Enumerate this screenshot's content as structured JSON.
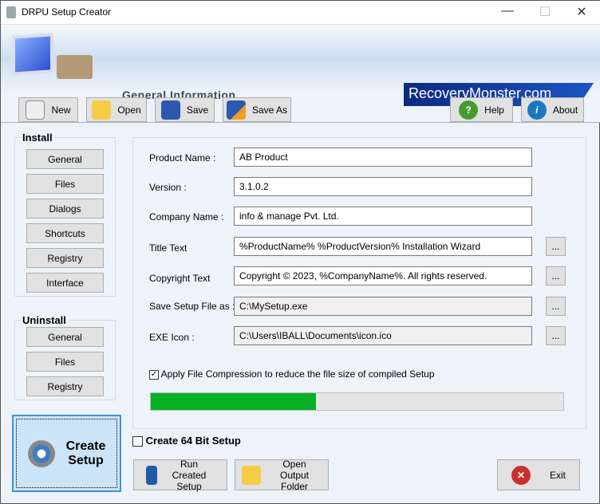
{
  "window": {
    "title": "DRPU Setup Creator",
    "minimize": "—",
    "maximize": "☐",
    "close": "✕"
  },
  "header": {
    "title": "General Information",
    "brand": "RecoveryMonster.com"
  },
  "toolbar": {
    "new": "New",
    "open": "Open",
    "save": "Save",
    "save_as": "Save As",
    "help": "Help",
    "about": "About"
  },
  "install": {
    "label": "Install",
    "items": [
      "General",
      "Files",
      "Dialogs",
      "Shortcuts",
      "Registry",
      "Interface"
    ]
  },
  "uninstall": {
    "label": "Uninstall",
    "items": [
      "General",
      "Files",
      "Registry"
    ]
  },
  "create_setup": {
    "line1": "Create",
    "line2": "Setup"
  },
  "form": {
    "fields": [
      {
        "label": "Product Name :",
        "value": "AB Product"
      },
      {
        "label": "Version :",
        "value": "3.1.0.2"
      },
      {
        "label": "Company Name :",
        "value": "info & manage Pvt. Ltd."
      },
      {
        "label": "Title Text",
        "value": "%ProductName% %ProductVersion% Installation Wizard"
      },
      {
        "label": "Copyright Text",
        "value": "Copyright © 2023, %CompanyName%. All rights reserved."
      },
      {
        "label": "Save Setup File as :",
        "value": "C:\\MySetup.exe"
      },
      {
        "label": "EXE Icon :",
        "value": "C:\\Users\\IBALL\\Documents\\icon.ico"
      }
    ],
    "browse": "...",
    "compression_label": "Apply File Compression to reduce the file size of compiled Setup",
    "compression_checked": true,
    "progress_percent": 40
  },
  "bit64": {
    "label": "Create 64 Bit Setup",
    "checked": false
  },
  "bottom": {
    "run": "Run Created Setup",
    "open_folder": "Open Output Folder",
    "exit": "Exit"
  },
  "colors": {
    "progress": "#06b025",
    "brand": "#1b54c4"
  }
}
